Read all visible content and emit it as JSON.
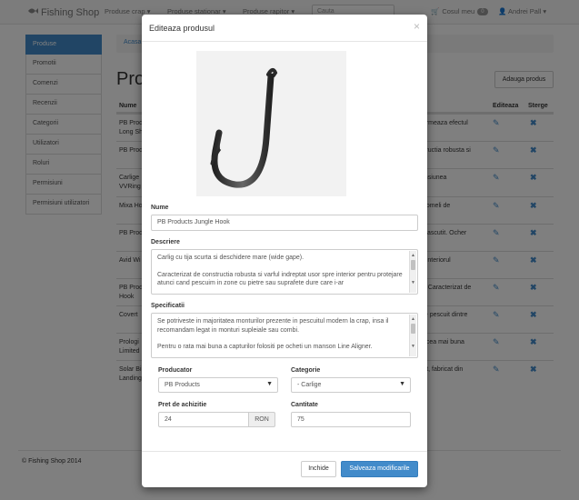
{
  "navbar": {
    "brand": "Fishing Shop",
    "items": [
      "Produse crap",
      "Produse stationar",
      "Produse rapitor"
    ],
    "search_placeholder": "Cauta",
    "cart_label": "Cosul meu",
    "cart_count": "0",
    "user": "Andrei Pall"
  },
  "sidebar": {
    "items": [
      "Produse",
      "Promotii",
      "Comenzi",
      "Recenzii",
      "Categorii",
      "Utilizatori",
      "Roluri",
      "Permisiuni",
      "Permisiuni utilizatori"
    ]
  },
  "breadcrumb": "Acasa",
  "page_title": "Produ",
  "add_button": "Adauga produs",
  "table": {
    "headers": {
      "name": "Nume",
      "edit": "Editeaza",
      "delete": "Sterge"
    },
    "rows": [
      {
        "name": "PB Produ Long Sh",
        "desc": "formeaza efectul"
      },
      {
        "name": "PB Prod",
        "desc": "structia robusta si"
      },
      {
        "name": "Carlige VVRing",
        "desc": "ensiunea"
      },
      {
        "name": "Mixa Ho",
        "desc": "momeli de"
      },
      {
        "name": "PB Prod",
        "desc": "si ascutit. Ocher"
      },
      {
        "name": "Avid Wi",
        "desc": "e interiorul"
      },
      {
        "name": "PB Prod Hook",
        "desc": "p. Caracterizat de"
      },
      {
        "name": "Covert",
        "desc": "de pescuit dintre"
      },
      {
        "name": "Prologi Limited",
        "desc": "e cea mai buna"
      },
      {
        "name": "Solar Bi Landing",
        "desc": "ert, fabricat din"
      }
    ]
  },
  "footer": "© Fishing Shop 2014",
  "modal": {
    "title": "Editeaza produsul",
    "close": "×",
    "image_icon": "fish-hook",
    "name_label": "Nume",
    "name_value": "PB Products Jungle Hook",
    "description_label": "Descriere",
    "description_lines": [
      "Carlig cu tija scurta si deschidere mare (wide gape).",
      "Caracterizat de constructia robusta si varful indreptat usor spre interior pentru protejare atunci cand pescuim in zone cu pietre sau suprafete dure care i-ar"
    ],
    "specs_label": "Specificatii",
    "specs_lines": [
      "Se potriveste in majoritatea monturilor prezente in pescuitul modern la crap, insa il recomandam legat in monturi supleiale sau combi.",
      "Pentru o rata mai buna a capturilor folositi pe ocheti un manson Line Aligner."
    ],
    "producer_label": "Producator",
    "producer_value": "PB Products",
    "category_label": "Categorie",
    "category_value": "- Carlige",
    "price_label": "Pret de achizitie",
    "price_value": "24",
    "currency": "RON",
    "quantity_label": "Cantitate",
    "quantity_value": "75",
    "cancel_button": "Inchide",
    "save_button": "Salveaza modificarile"
  }
}
